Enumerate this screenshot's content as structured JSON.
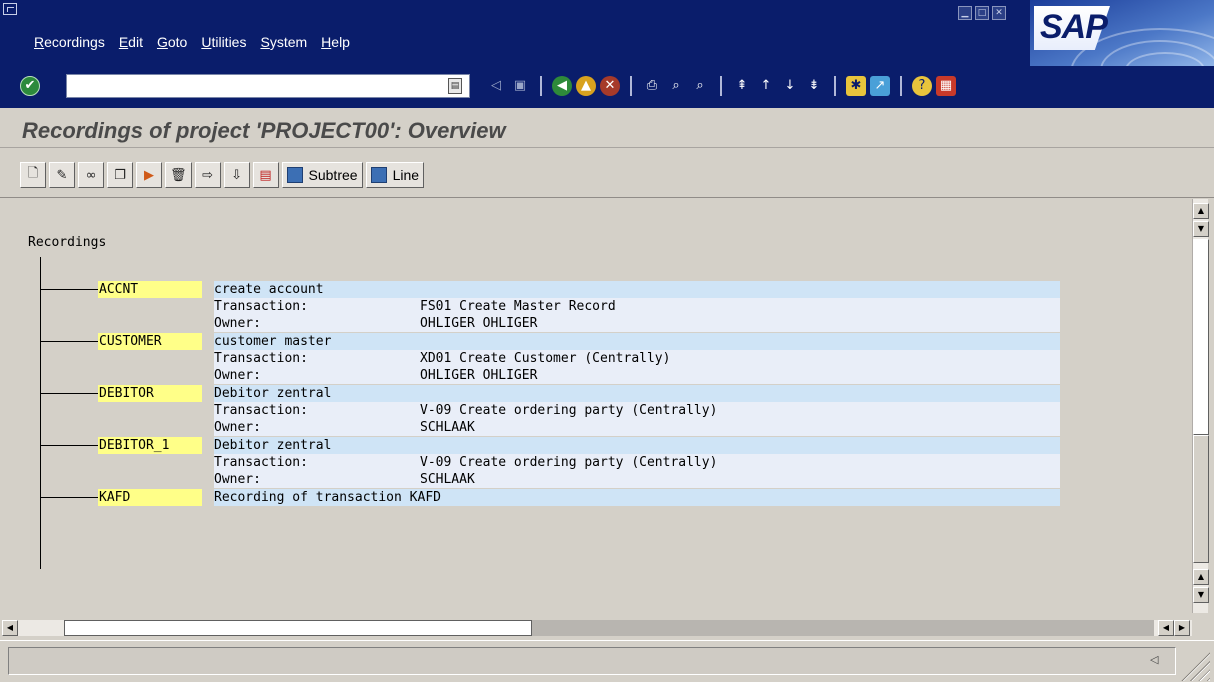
{
  "menu": [
    "Recordings",
    "Edit",
    "Goto",
    "Utilities",
    "System",
    "Help"
  ],
  "brand": "SAP",
  "screen_title": "Recordings of project 'PROJECT00': Overview",
  "app_toolbar": {
    "subtree_label": "Subtree",
    "line_label": "Line"
  },
  "tree": {
    "root": "Recordings",
    "nodes": [
      {
        "name": "ACCNT",
        "description": "create account",
        "transaction_label": "Transaction:",
        "transaction": "FS01 Create Master Record",
        "owner_label": "Owner:",
        "owner": "OHLIGER  OHLIGER"
      },
      {
        "name": "CUSTOMER",
        "description": "customer master",
        "transaction_label": "Transaction:",
        "transaction": "XD01 Create Customer (Centrally)",
        "owner_label": "Owner:",
        "owner": "OHLIGER  OHLIGER"
      },
      {
        "name": "DEBITOR",
        "description": "Debitor zentral",
        "transaction_label": "Transaction:",
        "transaction": "V-09 Create ordering party (Centrally)",
        "owner_label": "Owner:",
        "owner": "SCHLAAK"
      },
      {
        "name": "DEBITOR_1",
        "description": "Debitor zentral",
        "transaction_label": "Transaction:",
        "transaction": "V-09 Create ordering party (Centrally)",
        "owner_label": "Owner:",
        "owner": "SCHLAAK"
      },
      {
        "name": "KAFD",
        "description": "Recording of transaction KAFD"
      }
    ]
  },
  "colors": {
    "header_blue": "#0a1d6b",
    "row_head": "#cfe4f6",
    "row_sub": "#e9eef8",
    "node_highlight": "#ffff88"
  }
}
